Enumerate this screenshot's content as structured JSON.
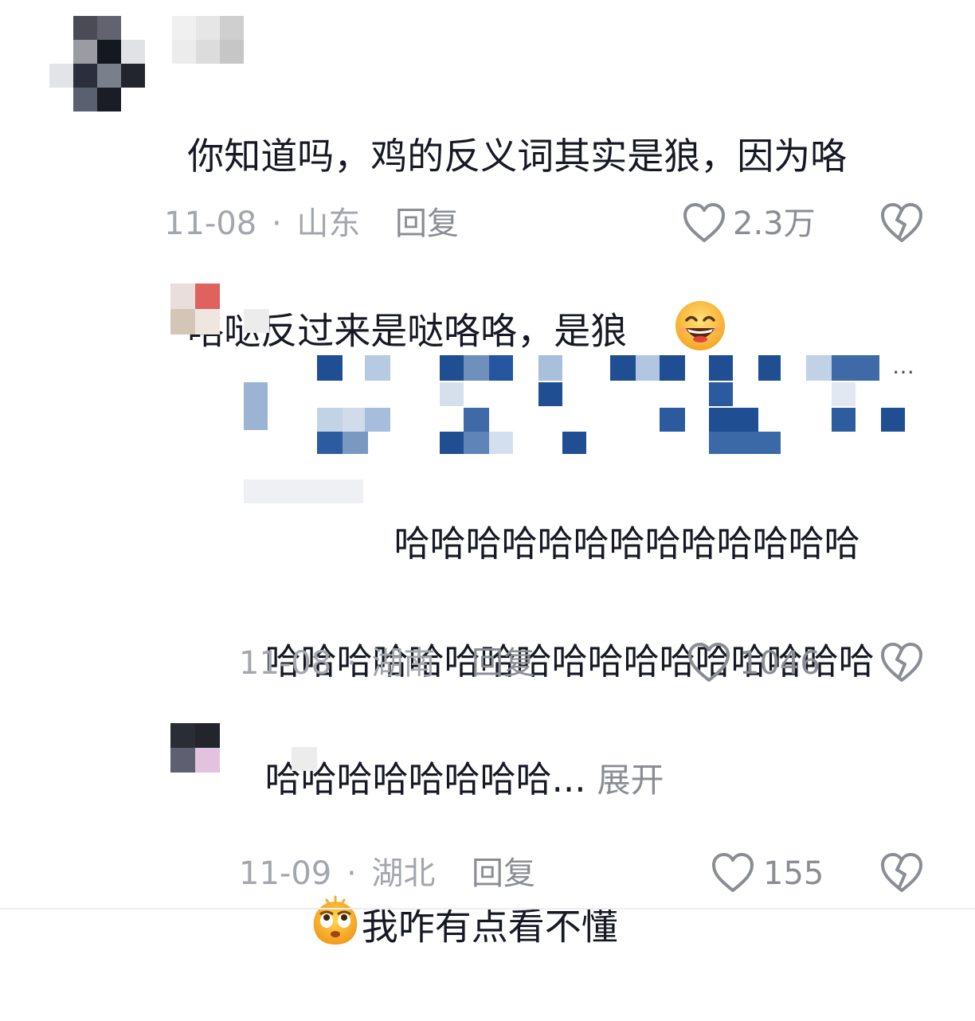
{
  "comments": [
    {
      "text_line1": "你知道吗，鸡的反义词其实是狼，因为咯",
      "text_line2": "咯哒反过来是哒咯咯，是狼",
      "date": "11-08",
      "separator": "·",
      "location": "山东",
      "reply_label": "回复",
      "likes": "2.3万",
      "emoji": "grinning-squint-emoji"
    },
    {
      "quoted_tail": "…",
      "text_line1": "哈哈哈哈哈哈哈哈哈哈哈哈哈",
      "text_line2": "哈哈哈哈哈哈哈哈哈哈哈哈哈哈哈哈哈",
      "text_line3": "哈哈哈哈哈哈哈哈...",
      "expand_label": "展开",
      "date": "11-08",
      "separator": "·",
      "location": "湖南",
      "reply_label": "回复",
      "likes": "1046"
    },
    {
      "text": "我咋有点看不懂",
      "date": "11-09",
      "separator": "·",
      "location": "湖北",
      "reply_label": "回复",
      "likes": "155",
      "emoji": "dizzy-face-emoji"
    }
  ],
  "icons": {
    "like": "heart-outline-icon",
    "dislike": "broken-heart-icon"
  },
  "colors": {
    "text": "#161823",
    "meta": "#a3a6ad",
    "action": "#8a8d93",
    "mosaic_blue": "#1f4e93"
  }
}
